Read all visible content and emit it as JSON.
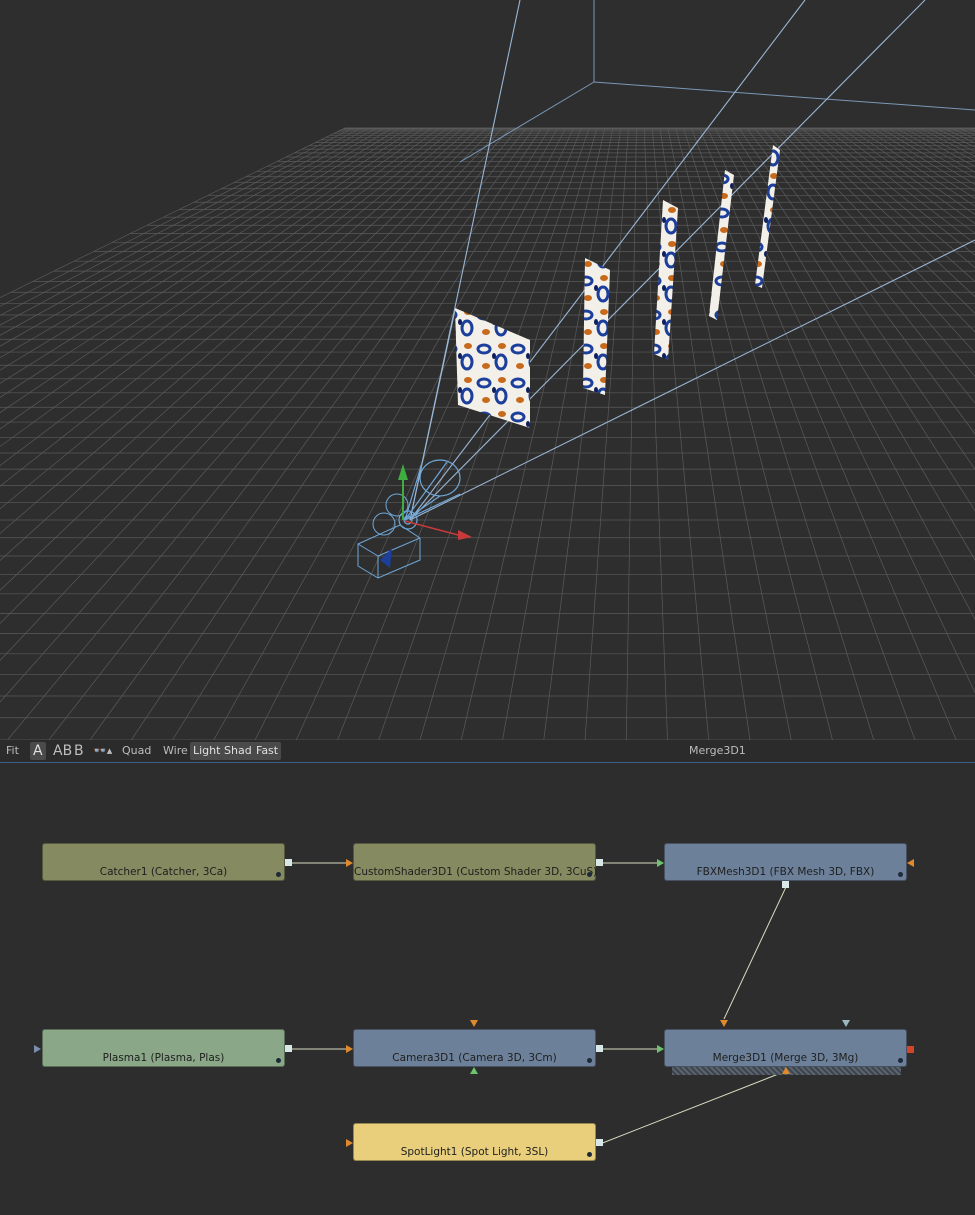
{
  "toolbar": {
    "fit": "Fit",
    "view_a": "A",
    "view_ab": "AB",
    "view_b": "B",
    "quad": "Quad",
    "wire": "Wire",
    "light": "Light",
    "shad": "Shad",
    "fast": "Fast",
    "title": "Merge3D1"
  },
  "nodes": [
    {
      "id": "catcher",
      "label": "Catcher1  (Catcher, 3Ca)",
      "color": "#858a60"
    },
    {
      "id": "customshader",
      "label": "CustomShader3D1  (Custom Shader 3D, 3CuS)",
      "color": "#858a60"
    },
    {
      "id": "fbxmesh",
      "label": "FBXMesh3D1  (FBX Mesh 3D, FBX)",
      "color": "#6d8099"
    },
    {
      "id": "plasma",
      "label": "Plasma1  (Plasma, Plas)",
      "color": "#8aa888"
    },
    {
      "id": "camera",
      "label": "Camera3D1  (Camera 3D, 3Cm)",
      "color": "#6d8099"
    },
    {
      "id": "merge",
      "label": "Merge3D1  (Merge 3D, 3Mg)",
      "color": "#6d8099"
    },
    {
      "id": "spotlight",
      "label": "SpotLight1  (Spot Light, 3SL)",
      "color": "#e9cf7b"
    }
  ],
  "colors": {
    "grid": "#5a5a5a",
    "grid_major": "#6a6a6a",
    "frustum": "#7fa6c9",
    "connection": "#d8dcc0",
    "selection": "#3d5f86"
  }
}
